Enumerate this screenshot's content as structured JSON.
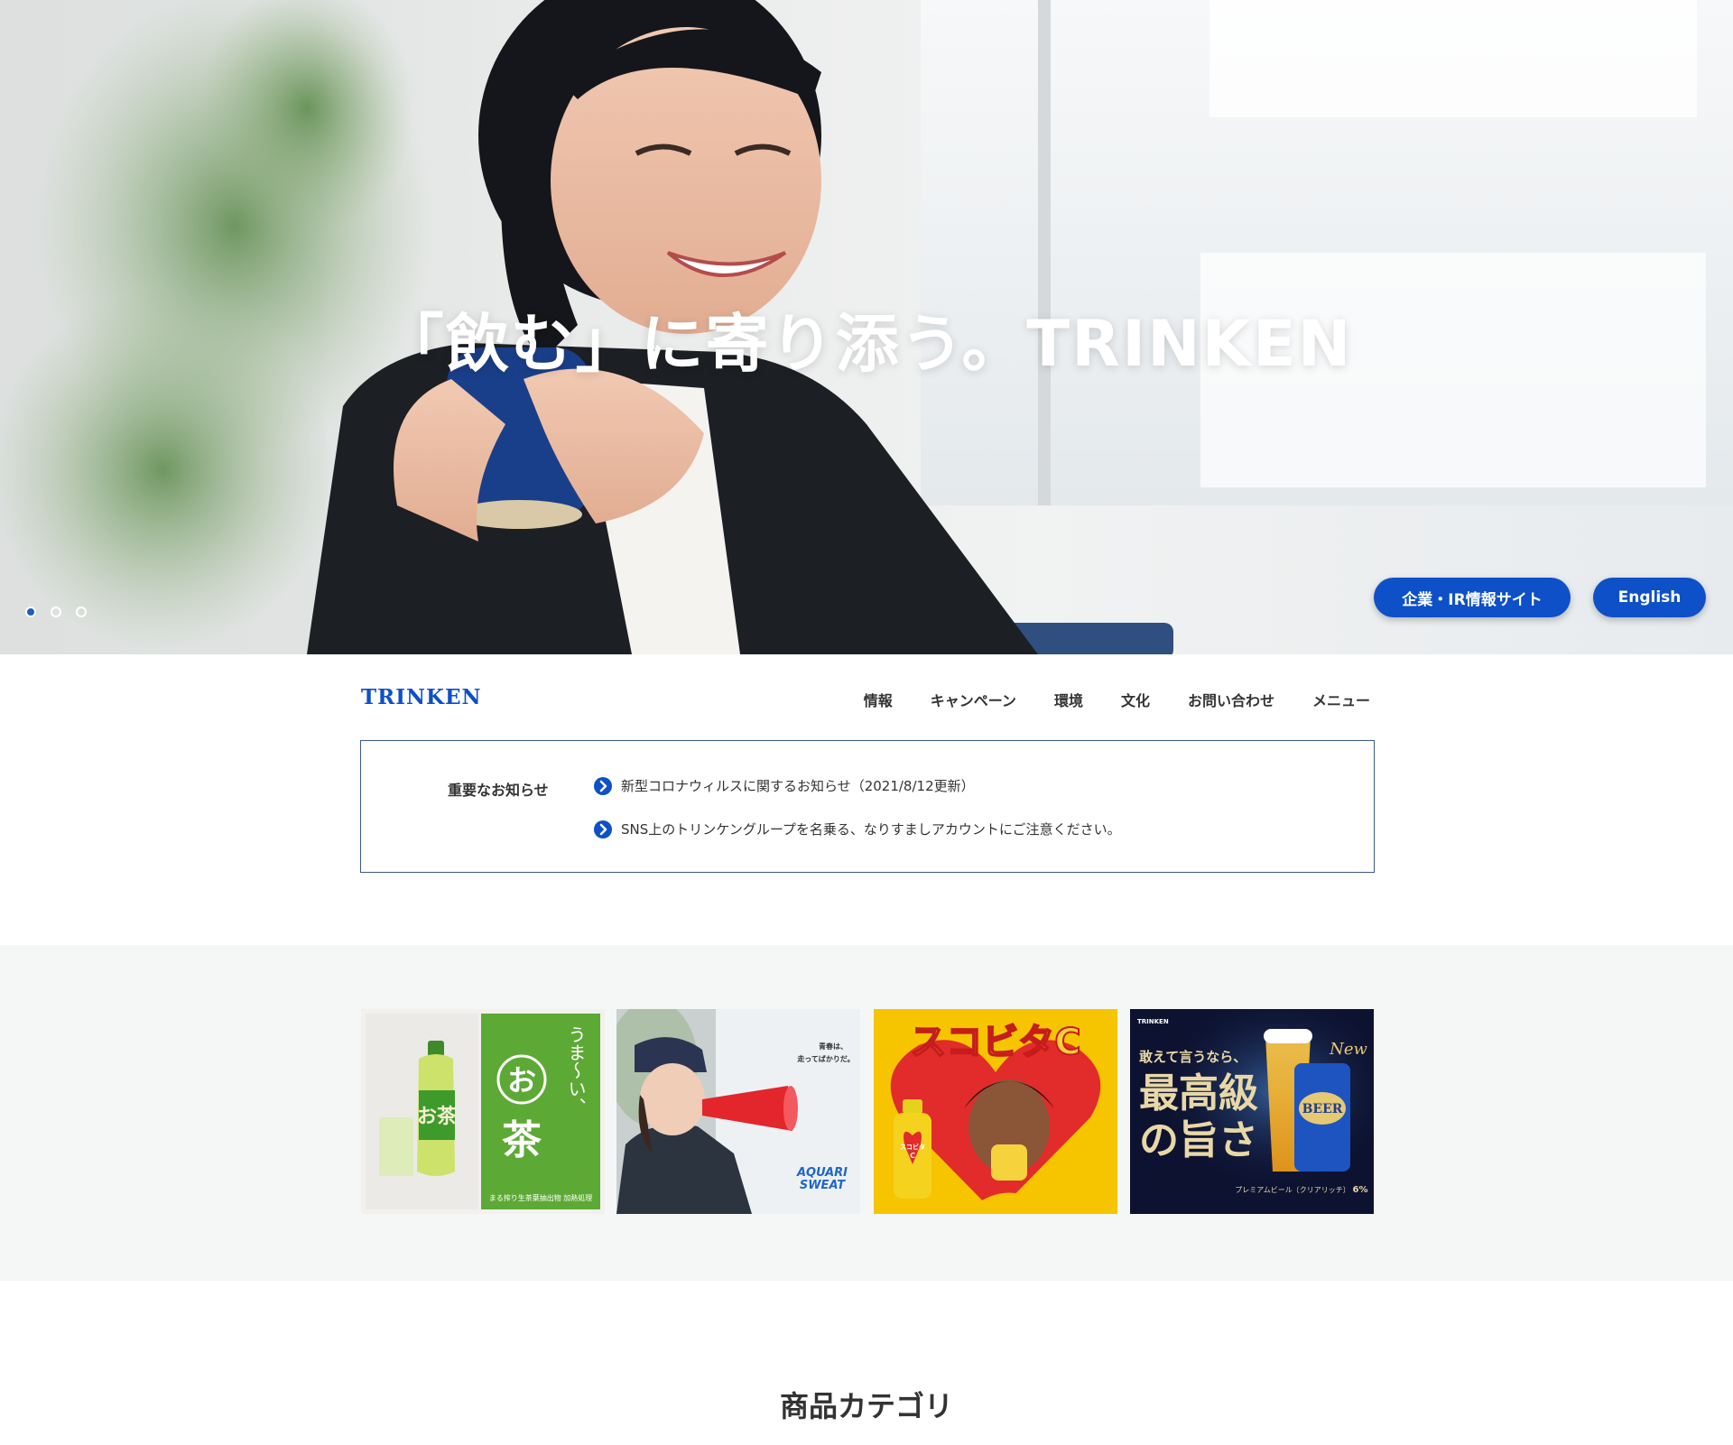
{
  "hero": {
    "headline": "「飲む」に寄り添う。TRINKEN",
    "ir_button": "企業・IR情報サイト",
    "english_button": "English",
    "slides": 3,
    "active_slide": 1
  },
  "nav": {
    "logo": "TRINKEN",
    "links": [
      "情報",
      "キャンペーン",
      "環境",
      "文化",
      "お問い合わせ",
      "メニュー"
    ]
  },
  "notice": {
    "title": "重要なお知らせ",
    "items": [
      "新型コロナウィルスに関するお知らせ（2021/8/12更新）",
      "SNS上のトリンケングループを名乗る、なりすましアカウントにご注意ください。"
    ]
  },
  "banners": {
    "ocha": {
      "big": "お茶",
      "tagline": "うま～い、",
      "brand": "お茶",
      "footer": "まる搾り生茶葉抽出物 加熱処理"
    },
    "aquari": {
      "copy1": "青春は、",
      "copy2": "走ってばかりだ。",
      "logo1": "AQUARI",
      "logo2": "SWEAT"
    },
    "sukobita": {
      "title": "スコビタC",
      "bottle1": "スコビタ",
      "bottle2": "C"
    },
    "beer": {
      "maker": "TRINKEN",
      "line1": "敢えて言うなら、",
      "line2": "最高級",
      "line3": "の旨さ",
      "new": "New",
      "can": "BEER",
      "product": "プレミアムビール〔クリアリッチ〕",
      "abv": "6%"
    }
  },
  "category": {
    "heading": "商品カテゴリ"
  },
  "colors": {
    "accent": "#0d50c8",
    "border": "#3a5a8c",
    "band": "#f4f7f6"
  }
}
